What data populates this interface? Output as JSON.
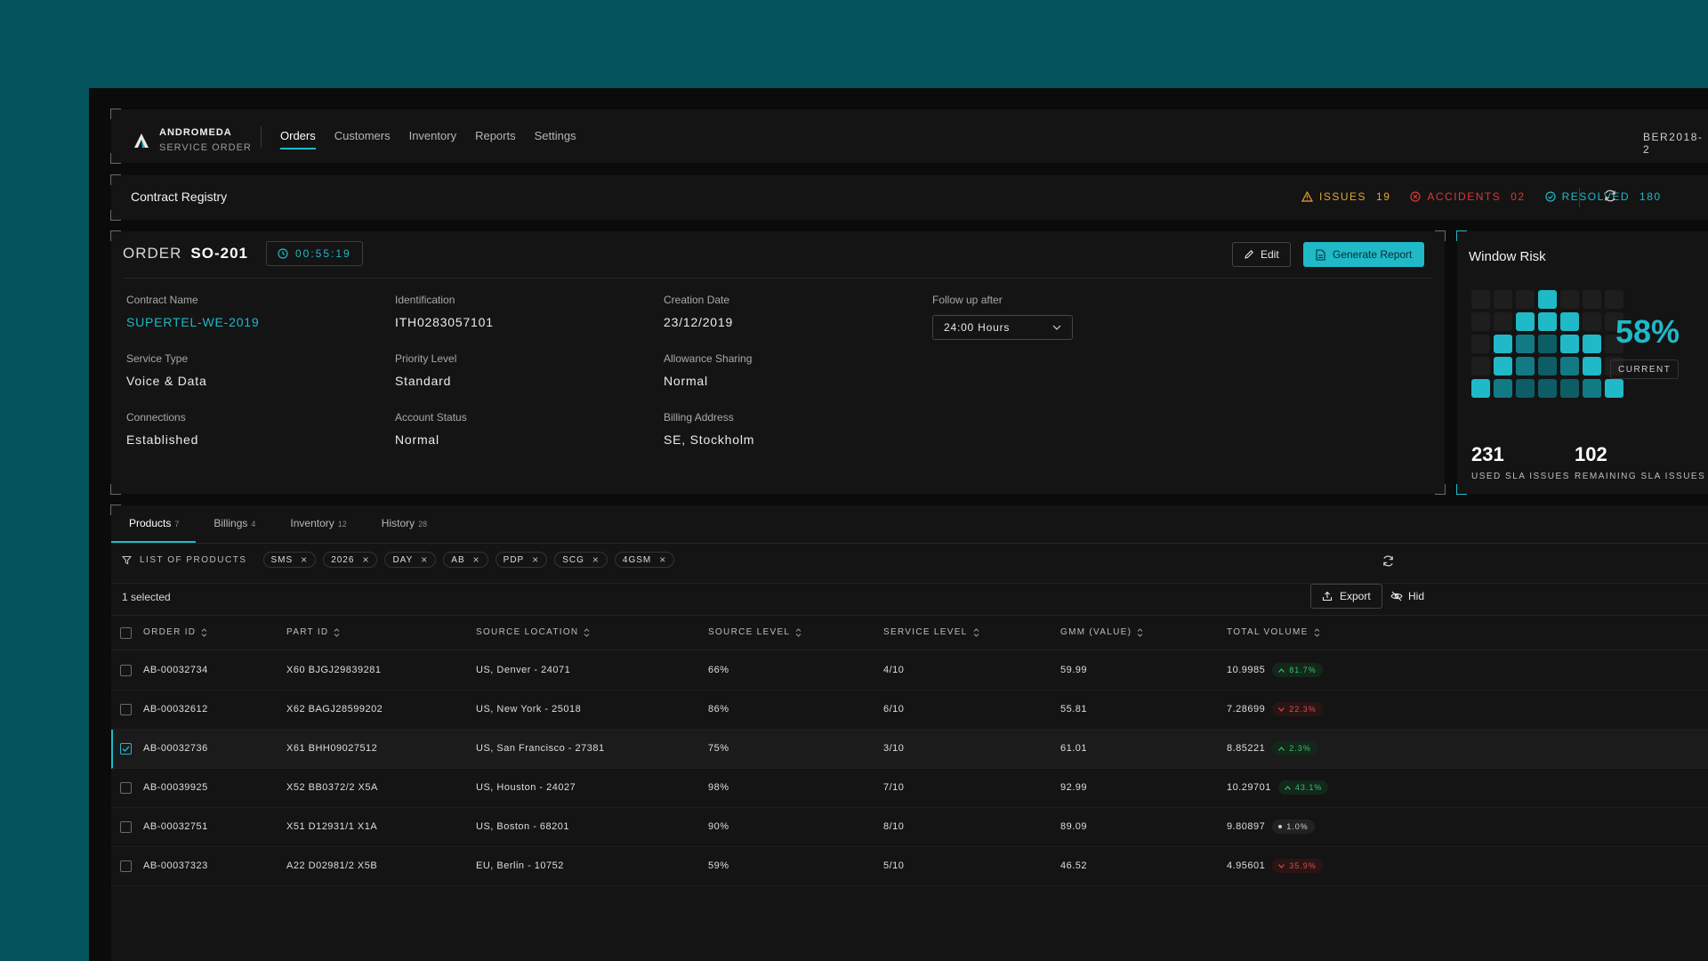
{
  "nav": {
    "brand_name": "ANDROMEDA",
    "brand_sub": "SERVICE ORDER",
    "links": [
      "Orders",
      "Customers",
      "Inventory",
      "Reports",
      "Settings"
    ],
    "active": "Orders",
    "account": "BER2018-2"
  },
  "registry": {
    "title": "Contract Registry",
    "issues_label": "ISSUES",
    "issues_count": "19",
    "accidents_label": "ACCIDENTS",
    "accidents_count": "02",
    "resolved_label": "RESOLVED",
    "resolved_count": "180"
  },
  "order": {
    "label": "ORDER",
    "id": "SO-201",
    "timer": "00:55:19",
    "edit_label": "Edit",
    "report_label": "Generate Report",
    "fields": {
      "contract_name": {
        "label": "Contract Name",
        "value": "SUPERTEL-WE-2019"
      },
      "identification": {
        "label": "Identification",
        "value": "ITH0283057101"
      },
      "creation_date": {
        "label": "Creation Date",
        "value": "23/12/2019"
      },
      "follow_up": {
        "label": "Follow up after",
        "value": "24:00 Hours"
      },
      "service_type": {
        "label": "Service Type",
        "value": "Voice & Data"
      },
      "priority_level": {
        "label": "Priority Level",
        "value": "Standard"
      },
      "allowance_sharing": {
        "label": "Allowance Sharing",
        "value": "Normal"
      },
      "connections": {
        "label": "Connections",
        "value": "Established"
      },
      "account_status": {
        "label": "Account Status",
        "value": "Normal"
      },
      "billing_address": {
        "label": "Billing Address",
        "value": "SE, Stockholm"
      }
    }
  },
  "risk": {
    "title": "Window Risk",
    "percent": "58%",
    "current_label": "CURRENT",
    "used": "231",
    "used_label": "USED SLA ISSUES",
    "remaining": "102",
    "remaining_label": "REMAINING SLA ISSUES",
    "grid": [
      [
        0,
        0,
        0,
        3,
        0,
        0,
        0
      ],
      [
        0,
        0,
        3,
        3,
        3,
        0,
        0
      ],
      [
        0,
        3,
        2,
        1,
        3,
        3,
        0
      ],
      [
        0,
        3,
        2,
        1,
        2,
        3,
        0
      ],
      [
        3,
        2,
        1,
        1,
        1,
        2,
        3
      ]
    ]
  },
  "tabs": [
    {
      "label": "Products",
      "count": "7"
    },
    {
      "label": "Billings",
      "count": "4"
    },
    {
      "label": "Inventory",
      "count": "12"
    },
    {
      "label": "History",
      "count": "28"
    }
  ],
  "filters": {
    "label": "LIST OF PRODUCTS",
    "chips": [
      "SMS",
      "2026",
      "DAY",
      "AB",
      "PDP",
      "SCG",
      "4GSM"
    ]
  },
  "table": {
    "selected_text": "1 selected",
    "export_label": "Export",
    "hide_label": "Hid",
    "columns": [
      "ORDER ID",
      "PART ID",
      "SOURCE LOCATION",
      "SOURCE LEVEL",
      "SERVICE LEVEL",
      "GMM (VALUE)",
      "TOTAL VOLUME"
    ],
    "rows": [
      {
        "order_id": "AB-00032734",
        "part_id": "X60 BJGJ29839281",
        "location": "US, Denver - 24071",
        "source_level": "66%",
        "service_level": "4/10",
        "gmm": "59.99",
        "volume": "10.9985",
        "trend": "81.7%",
        "dir": "up",
        "checked": false
      },
      {
        "order_id": "AB-00032612",
        "part_id": "X62 BAGJ28599202",
        "location": "US, New York - 25018",
        "source_level": "86%",
        "service_level": "6/10",
        "gmm": "55.81",
        "volume": "7.28699",
        "trend": "22.3%",
        "dir": "down",
        "checked": false
      },
      {
        "order_id": "AB-00032736",
        "part_id": "X61 BHH09027512",
        "location": "US, San Francisco - 27381",
        "source_level": "75%",
        "service_level": "3/10",
        "gmm": "61.01",
        "volume": "8.85221",
        "trend": "2.3%",
        "dir": "up",
        "checked": true
      },
      {
        "order_id": "AB-00039925",
        "part_id": "X52 BB0372/2 X5A",
        "location": "US, Houston - 24027",
        "source_level": "98%",
        "service_level": "7/10",
        "gmm": "92.99",
        "volume": "10.29701",
        "trend": "43.1%",
        "dir": "up",
        "checked": false
      },
      {
        "order_id": "AB-00032751",
        "part_id": "X51 D12931/1 X1A",
        "location": "US, Boston - 68201",
        "source_level": "90%",
        "service_level": "8/10",
        "gmm": "89.09",
        "volume": "9.80897",
        "trend": "1.0%",
        "dir": "flat",
        "checked": false
      },
      {
        "order_id": "AB-00037323",
        "part_id": "A22 D02981/2 X5B",
        "location": "EU, Berlin - 10752",
        "source_level": "59%",
        "service_level": "5/10",
        "gmm": "46.52",
        "volume": "4.95601",
        "trend": "35.9%",
        "dir": "down",
        "checked": false
      }
    ]
  },
  "colors": {
    "accent": "#1fb9c8",
    "warning": "#e9a530",
    "danger": "#e0363a",
    "success": "#3ac06e"
  }
}
